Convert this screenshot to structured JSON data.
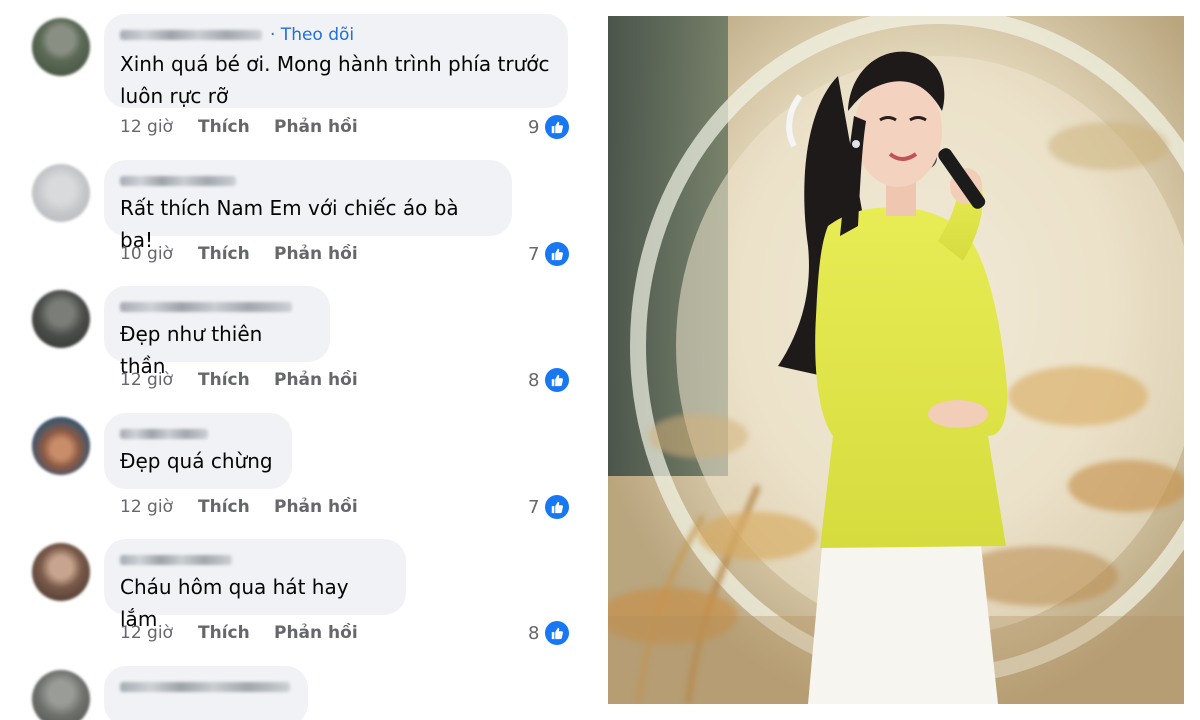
{
  "comments": [
    {
      "time": "12 giờ",
      "like": "Thích",
      "reply": "Phản hồi",
      "text_lines": [
        "Xinh quá bé ơi. Mong hành trình phía trước",
        "luôn rực rỡ"
      ],
      "follow": "· Theo dõi",
      "reactions": "9"
    },
    {
      "time": "10 giờ",
      "like": "Thích",
      "reply": "Phản hồi",
      "text_lines": [
        "Rất thích Nam Em với chiếc áo bà ba!"
      ],
      "reactions": "7"
    },
    {
      "time": "12 giờ",
      "like": "Thích",
      "reply": "Phản hồi",
      "text_lines": [
        "Đẹp như thiên thần"
      ],
      "reactions": "8"
    },
    {
      "time": "12 giờ",
      "like": "Thích",
      "reply": "Phản hồi",
      "text_lines": [
        "Đẹp quá chừng"
      ],
      "reactions": "7"
    },
    {
      "time": "12 giờ",
      "like": "Thích",
      "reply": "Phản hồi",
      "text_lines": [
        "Cháu hôm qua hát hay lắm"
      ],
      "reactions": "8"
    }
  ],
  "colors": {
    "bubble": "#f0f2f5",
    "follow_link": "#216fdb",
    "meta_text": "#65676b",
    "like_badge": "#1877f2",
    "dress": "#dfe64a",
    "skirt": "#f7f5f0"
  },
  "icons": {
    "reaction": "thumbs-up-icon",
    "avatar": "blurred-avatar"
  }
}
